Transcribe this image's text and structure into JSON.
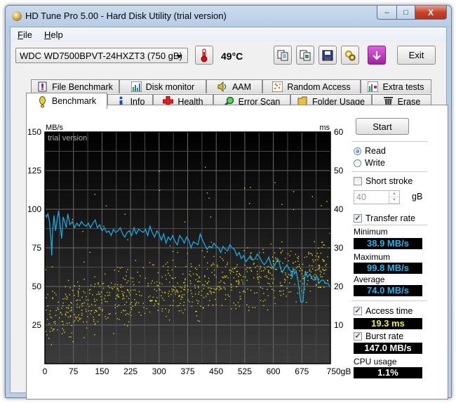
{
  "window": {
    "title": "HD Tune Pro 5.00 - Hard Disk Utility (trial version)",
    "controls": {
      "minimize": "–",
      "maximize": "□",
      "close": "X"
    }
  },
  "menu": {
    "items": [
      {
        "label": "File",
        "accel": "F",
        "rest": "ile"
      },
      {
        "label": "Help",
        "accel": "H",
        "rest": "elp"
      }
    ]
  },
  "toolbar": {
    "drive_selected": "WDC WD7500BPVT-24HXZT3 (750 gB)",
    "temperature": "49°C",
    "icons": [
      "copy-text-icon",
      "copy-screenshot-icon",
      "save-icon",
      "options-icon",
      "download-icon"
    ],
    "exit_label": "Exit"
  },
  "tabs": {
    "row_back": [
      {
        "label": "File Benchmark",
        "icon": "file-benchmark-icon"
      },
      {
        "label": "Disk monitor",
        "icon": "disk-monitor-icon"
      },
      {
        "label": "AAM",
        "icon": "speaker-icon"
      },
      {
        "label": "Random Access",
        "icon": "random-access-icon"
      },
      {
        "label": "Extra tests",
        "icon": "extra-tests-icon"
      }
    ],
    "row_front": [
      {
        "label": "Benchmark",
        "icon": "exclamation-icon",
        "active": true
      },
      {
        "label": "Info",
        "icon": "info-icon"
      },
      {
        "label": "Health",
        "icon": "health-cross-icon"
      },
      {
        "label": "Error Scan",
        "icon": "magnifier-icon"
      },
      {
        "label": "Folder Usage",
        "icon": "folder-icon"
      },
      {
        "label": "Erase",
        "icon": "trash-icon"
      }
    ]
  },
  "side": {
    "start_label": "Start",
    "mode": {
      "read": "Read",
      "write": "Write",
      "selected": "read"
    },
    "short_stroke": {
      "label": "Short stroke",
      "checked": false,
      "value": "40",
      "unit": "gB"
    },
    "transfer_rate": {
      "label": "Transfer rate",
      "checked": true
    },
    "minimum": {
      "label": "Minimum",
      "value": "38.9 MB/s"
    },
    "maximum": {
      "label": "Maximum",
      "value": "99.8 MB/s"
    },
    "average": {
      "label": "Average",
      "value": "74.0 MB/s"
    },
    "access_time": {
      "label": "Access time",
      "checked": true,
      "value": "19.3 ms"
    },
    "burst_rate": {
      "label": "Burst rate",
      "checked": true,
      "value": "147.0 MB/s"
    },
    "cpu_usage": {
      "label": "CPU usage",
      "value": "1.1%"
    }
  },
  "colors": {
    "transfer_line": "#1ba7e0",
    "access_points": "#d8d020",
    "stat_blue": "#22b4f0",
    "stat_yellow": "#f0f020",
    "stat_white": "#ffffff"
  },
  "chart_data": {
    "type": "line",
    "title": "",
    "watermark": "trial version",
    "xlabel": "gB",
    "ylabel_left": "MB/s",
    "ylabel_right": "ms",
    "xlim": [
      0,
      750
    ],
    "ylim_left": [
      0,
      150
    ],
    "ylim_right": [
      0,
      60
    ],
    "x_ticks": [
      "0",
      "75",
      "150",
      "225",
      "300",
      "375",
      "450",
      "525",
      "600",
      "675",
      "750gB"
    ],
    "y_ticks_left": [
      "25",
      "50",
      "75",
      "100",
      "125",
      "150"
    ],
    "y_ticks_right": [
      "10",
      "20",
      "30",
      "40",
      "50",
      "60"
    ],
    "grid": true,
    "series": [
      {
        "name": "Transfer rate",
        "axis": "left",
        "unit": "MB/s",
        "x": [
          0,
          4,
          8,
          12,
          16,
          18,
          20,
          24,
          28,
          32,
          36,
          40,
          44,
          48,
          52,
          56,
          60,
          66,
          72,
          78,
          84,
          90,
          96,
          102,
          108,
          114,
          120,
          126,
          132,
          138,
          144,
          150,
          156,
          162,
          168,
          174,
          180,
          186,
          192,
          198,
          204,
          210,
          216,
          222,
          228,
          234,
          240,
          246,
          252,
          258,
          264,
          270,
          276,
          282,
          288,
          294,
          300,
          306,
          312,
          318,
          324,
          330,
          336,
          342,
          348,
          354,
          360,
          366,
          372,
          378,
          384,
          390,
          396,
          402,
          408,
          414,
          420,
          426,
          432,
          438,
          444,
          450,
          456,
          462,
          468,
          474,
          480,
          486,
          492,
          498,
          504,
          510,
          516,
          522,
          528,
          534,
          540,
          546,
          552,
          558,
          564,
          570,
          576,
          582,
          588,
          594,
          600,
          606,
          612,
          618,
          624,
          630,
          636,
          642,
          646,
          648,
          650,
          652,
          656,
          660,
          666,
          672,
          678,
          684,
          690,
          696,
          702,
          708,
          714,
          720,
          726,
          732,
          738,
          744,
          750
        ],
        "values": [
          97,
          95,
          97,
          92,
          80,
          70,
          85,
          96,
          86,
          93,
          99,
          90,
          81,
          95,
          92,
          88,
          97,
          90,
          92,
          88,
          91,
          89,
          92,
          90,
          89,
          91,
          88,
          91,
          93,
          88,
          90,
          86,
          88,
          85,
          86,
          83,
          87,
          85,
          86,
          88,
          84,
          82,
          85,
          86,
          83,
          88,
          84,
          87,
          86,
          85,
          87,
          83,
          89,
          85,
          82,
          86,
          84,
          80,
          84,
          78,
          82,
          80,
          83,
          79,
          77,
          83,
          81,
          78,
          82,
          80,
          75,
          79,
          78,
          77,
          84,
          80,
          77,
          74,
          76,
          75,
          78,
          76,
          75,
          72,
          76,
          74,
          73,
          77,
          75,
          74,
          70,
          72,
          68,
          70,
          66,
          68,
          70,
          67,
          68,
          71,
          69,
          66,
          64,
          66,
          69,
          64,
          62,
          65,
          68,
          63,
          59,
          62,
          64,
          61,
          60,
          57,
          56,
          62,
          58,
          60,
          52,
          40,
          40,
          60,
          56,
          58,
          55,
          54,
          57,
          52,
          54,
          54,
          52,
          52,
          49,
          47
        ]
      },
      {
        "name": "Access time",
        "axis": "right",
        "unit": "ms",
        "style": "scatter",
        "trend_ms": {
          "0": 12,
          "150": 16,
          "300": 19,
          "450": 21,
          "600": 23,
          "750": 25
        },
        "spread_ms": 6,
        "outlier_examples_ms": [
          {
            "x": 300,
            "y": 50
          },
          {
            "x": 420,
            "y": 51
          },
          {
            "x": 130,
            "y": 44
          },
          {
            "x": 300,
            "y": 45
          },
          {
            "x": 160,
            "y": 41
          },
          {
            "x": 430,
            "y": 43
          }
        ]
      }
    ]
  }
}
